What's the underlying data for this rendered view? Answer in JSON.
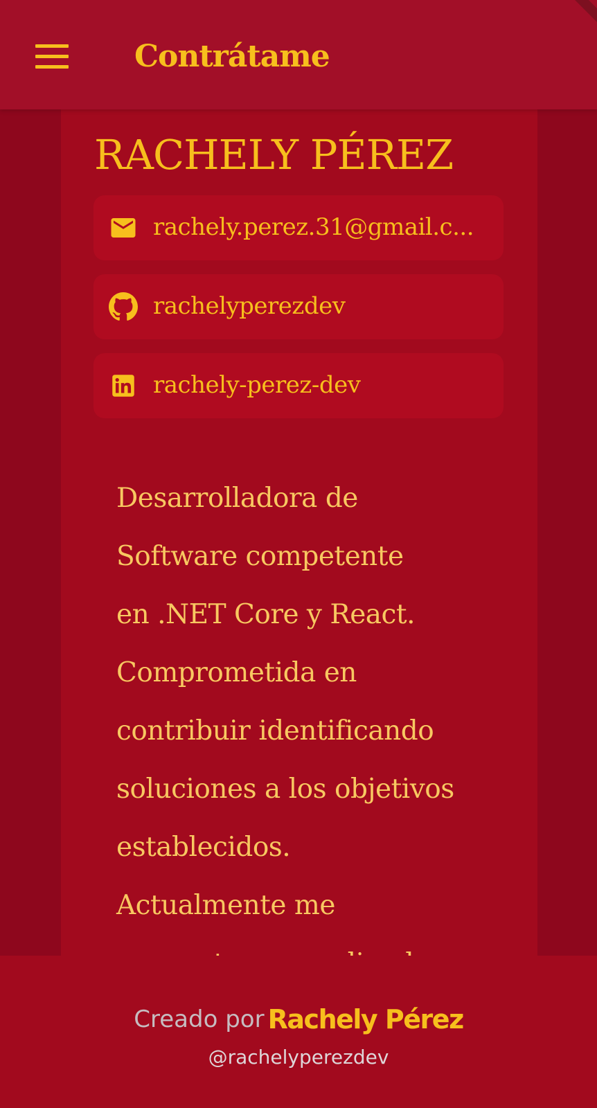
{
  "appbar": {
    "menu_icon": "hamburger-menu-icon",
    "title": "Contrátame"
  },
  "profile": {
    "name": "RACHELY PÉREZ",
    "contacts": [
      {
        "icon": "email-icon",
        "label": "rachely.perez.31@gmail.c..."
      },
      {
        "icon": "github-icon",
        "label": "rachelyperezdev"
      },
      {
        "icon": "linkedin-icon",
        "label": "rachely-perez-dev"
      }
    ],
    "bio_lines": [
      "Desarrolladora de",
      "Software competente",
      "en .NET Core y React.",
      "Comprometida en",
      "contribuir identificando",
      "soluciones a los objetivos",
      "establecidos.",
      "Actualmente me",
      "encuentro aprendiendo"
    ]
  },
  "footer": {
    "prefix": "Creado por",
    "author": "Rachely Pérez",
    "handle": "@rachelyperezdev"
  },
  "colors": {
    "background": "#8e071d",
    "appbar": "#a20f28",
    "card": "#a20a1e",
    "contact_tile": "#b00b20",
    "accent": "#f7bf1d",
    "bio_text": "#f8c861"
  }
}
